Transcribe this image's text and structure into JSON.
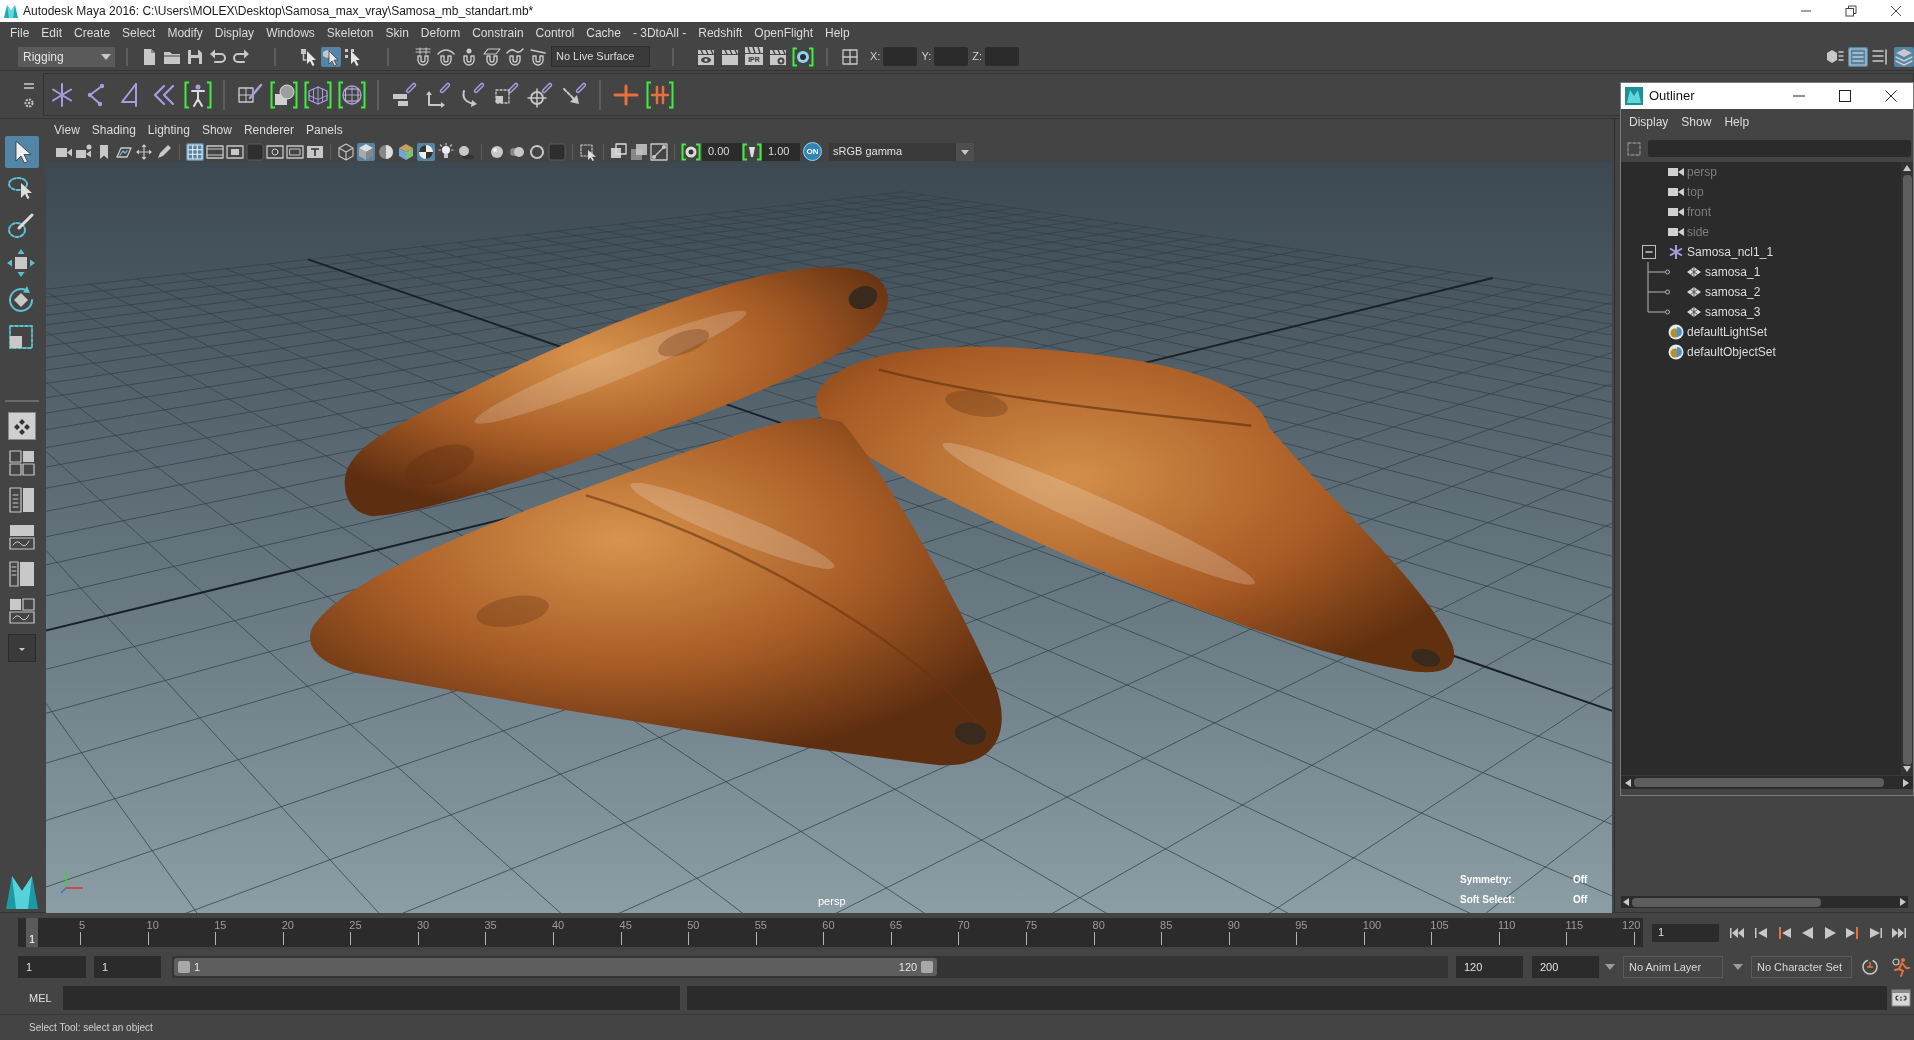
{
  "window": {
    "title": "Autodesk Maya 2016: C:\\Users\\MOLEX\\Desktop\\Samosa_max_vray\\Samosa_mb_standart.mb*"
  },
  "menu_bar": [
    "File",
    "Edit",
    "Create",
    "Select",
    "Modify",
    "Display",
    "Windows",
    "Skeleton",
    "Skin",
    "Deform",
    "Constrain",
    "Control",
    "Cache",
    "- 3DtoAll -",
    "Redshift",
    "OpenFlight",
    "Help"
  ],
  "status_line": {
    "menu_set": "Rigging",
    "select_modes": [
      {
        "selected": false
      },
      {
        "selected": true
      },
      {
        "selected": false
      }
    ],
    "live_surface": "No Live Surface",
    "render_ipr": "IPR",
    "coordinates": [
      {
        "label": "X:"
      },
      {
        "label": "Y:"
      },
      {
        "label": "Z:"
      }
    ],
    "panel_toggles": [
      {
        "selected": false
      },
      {
        "selected": true
      },
      {
        "selected": false
      },
      {
        "selected": true
      }
    ]
  },
  "toolbox": {
    "tools": [
      {
        "selected": true
      },
      {
        "selected": false
      },
      {
        "selected": false
      },
      {
        "selected": false
      },
      {
        "selected": false
      },
      {
        "selected": false
      }
    ],
    "layouts": [
      {
        "selected": true
      },
      {
        "selected": false
      },
      {
        "selected": false
      },
      {
        "selected": false
      },
      {
        "selected": false
      },
      {
        "selected": false
      }
    ]
  },
  "viewport": {
    "menu": [
      "View",
      "Shading",
      "Lighting",
      "Show",
      "Renderer",
      "Panels"
    ],
    "toolbar_toggles": [
      {
        "selected": false
      },
      {
        "selected": false
      },
      {
        "selected": false
      },
      {
        "selected": false
      },
      {
        "selected": false
      },
      {
        "selected": false
      },
      {
        "selected": true
      },
      {
        "selected": false
      },
      {
        "selected": false
      },
      {
        "selected": false
      },
      {
        "selected": false
      },
      {
        "selected": false
      },
      {
        "selected": false
      },
      {
        "selected": false
      },
      {
        "selected": true
      },
      {
        "selected": false
      },
      {
        "selected": false
      },
      {
        "selected": true
      },
      {
        "selected": false
      },
      {
        "selected": false
      },
      {
        "selected": false
      },
      {
        "selected": false
      },
      {
        "selected": false
      },
      {
        "selected": false
      },
      {
        "selected": false
      },
      {
        "selected": false
      },
      {
        "selected": false
      },
      {
        "selected": false
      }
    ],
    "exposure": "0.00",
    "gamma": "1.00",
    "color_management": "ON",
    "color_space": "sRGB gamma",
    "camera": "persp",
    "hud": [
      {
        "label": "Symmetry:",
        "value": "Off"
      },
      {
        "label": "Soft Select:",
        "value": "Off"
      }
    ]
  },
  "outliner": {
    "title": "Outliner",
    "menu": [
      "Display",
      "Show",
      "Help"
    ],
    "items": [
      {
        "name": "persp",
        "kind": "camera",
        "dimmed": true
      },
      {
        "name": "top",
        "kind": "camera",
        "dimmed": true
      },
      {
        "name": "front",
        "kind": "camera",
        "dimmed": true
      },
      {
        "name": "side",
        "kind": "camera",
        "dimmed": true
      },
      {
        "name": "Samosa_ncl1_1",
        "kind": "group",
        "dimmed": false,
        "expanded": true,
        "children": [
          {
            "name": "samosa_1",
            "kind": "mesh",
            "dimmed": false
          },
          {
            "name": "samosa_2",
            "kind": "mesh",
            "dimmed": false
          },
          {
            "name": "samosa_3",
            "kind": "mesh",
            "dimmed": false
          }
        ]
      },
      {
        "name": "defaultLightSet",
        "kind": "set",
        "dimmed": false
      },
      {
        "name": "defaultObjectSet",
        "kind": "set",
        "dimmed": false
      }
    ]
  },
  "time_slider": {
    "ticks": [
      "5",
      "10",
      "15",
      "20",
      "25",
      "30",
      "35",
      "40",
      "45",
      "50",
      "55",
      "60",
      "65",
      "70",
      "75",
      "80",
      "85",
      "90",
      "95",
      "100",
      "105",
      "110",
      "115",
      "120"
    ],
    "current_frame": "1",
    "level": 0,
    "current_frame_field": "1"
  },
  "range_slider": {
    "start": "1",
    "playback_start": "1",
    "range_start": "1",
    "range_end": "120",
    "level": 0.6,
    "playback_end": "120",
    "end": "200",
    "anim_layer": "No Anim Layer",
    "character_set": "No Character Set"
  },
  "command_line": {
    "language": "MEL"
  },
  "help_line": "Select Tool: select an object"
}
